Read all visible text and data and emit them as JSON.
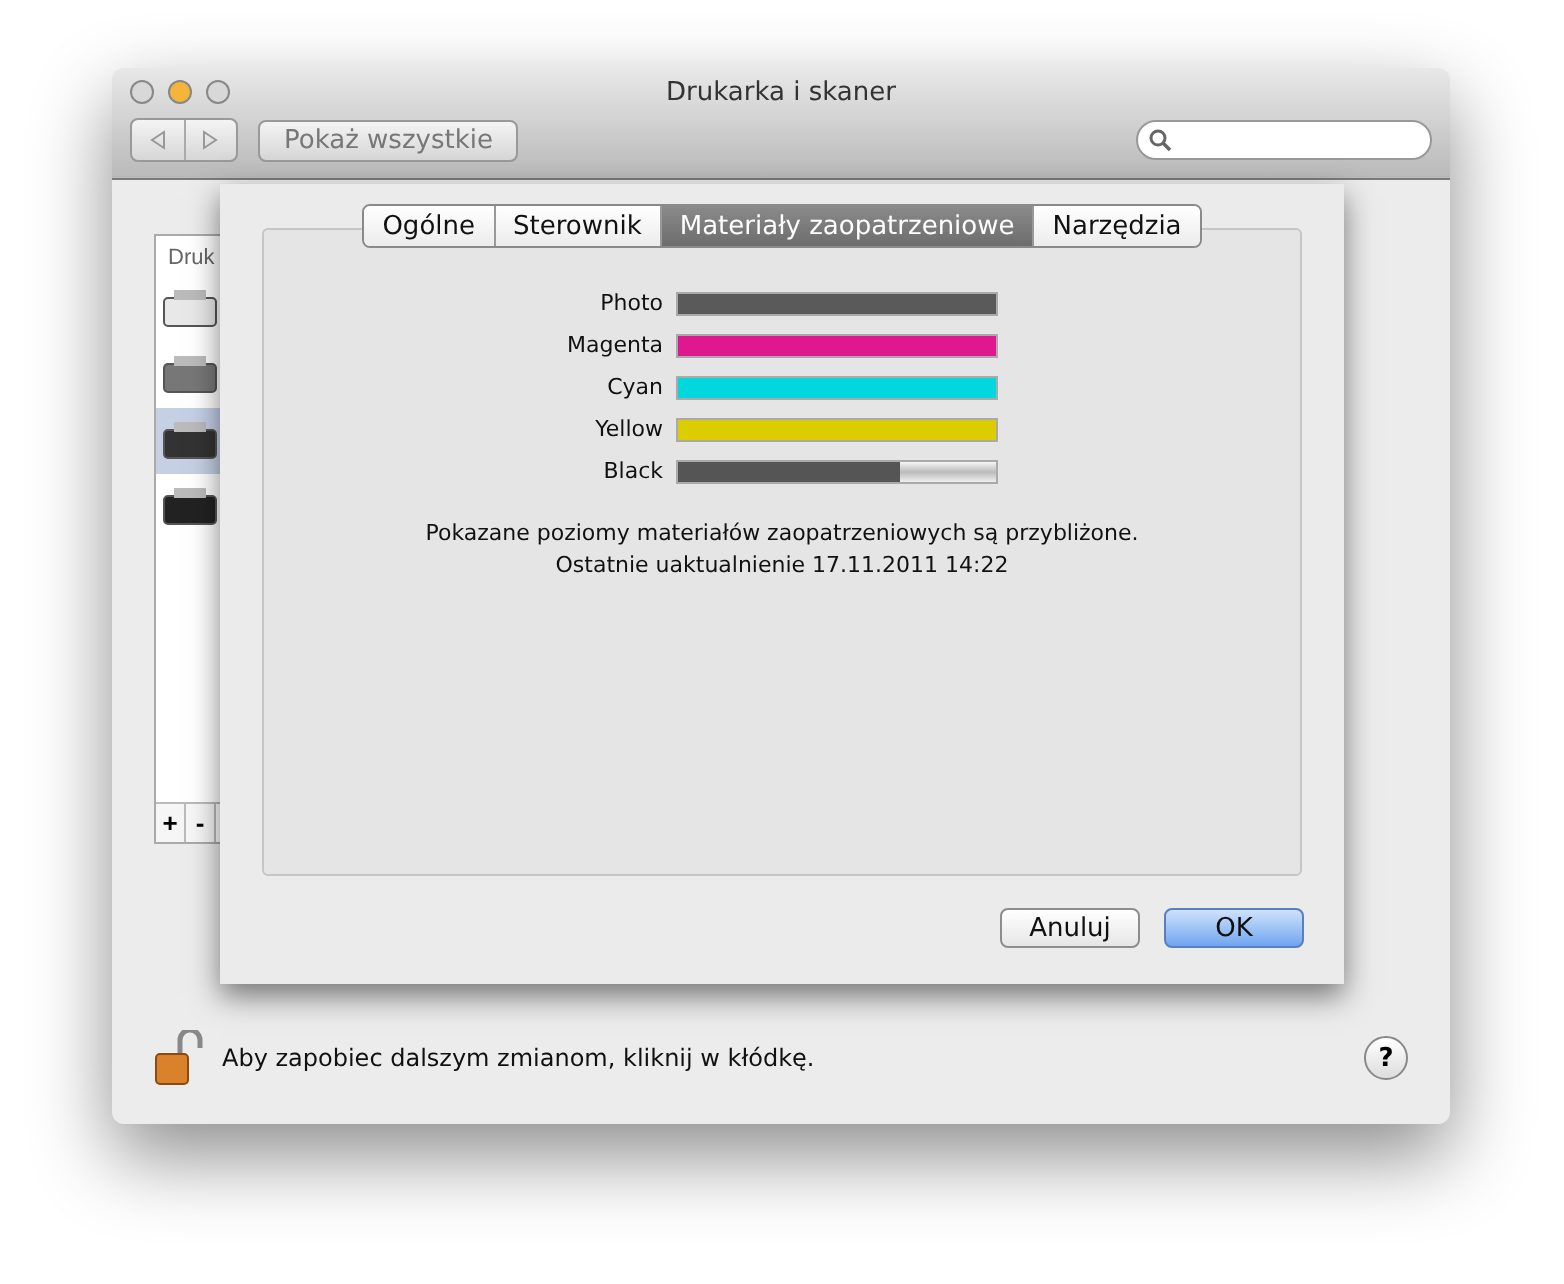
{
  "window": {
    "title": "Drukarka i skaner"
  },
  "toolbar": {
    "show_all": "Pokaż wszystkie"
  },
  "sidebar": {
    "header": "Druk",
    "printers": [
      {
        "selected": false
      },
      {
        "selected": false
      },
      {
        "selected": true
      },
      {
        "selected": false
      }
    ],
    "add": "+",
    "remove": "-"
  },
  "sheet": {
    "tabs": [
      {
        "label": "Ogólne",
        "selected": false
      },
      {
        "label": "Sterownik",
        "selected": false
      },
      {
        "label": "Materiały zaopatrzeniowe",
        "selected": true
      },
      {
        "label": "Narzędzia",
        "selected": false
      }
    ],
    "supplies": [
      {
        "name": "Photo",
        "level": 1,
        "color": "#5a5a5a"
      },
      {
        "name": "Magenta",
        "level": 1,
        "color": "#e01890"
      },
      {
        "name": "Cyan",
        "level": 1,
        "color": "#00d8de"
      },
      {
        "name": "Yellow",
        "level": 1,
        "color": "#dccd00"
      },
      {
        "name": "Black",
        "level": 0.7,
        "color": "#555555"
      }
    ],
    "note": "Pokazane poziomy materiałów zaopatrzeniowych są przybliżone.",
    "updated": "Ostatnie uaktualnienie 17.11.2011 14:22",
    "cancel": "Anuluj",
    "ok": "OK"
  },
  "footer": {
    "lock_text": "Aby zapobiec dalszym zmianom, kliknij w kłódkę.",
    "help": "?"
  }
}
